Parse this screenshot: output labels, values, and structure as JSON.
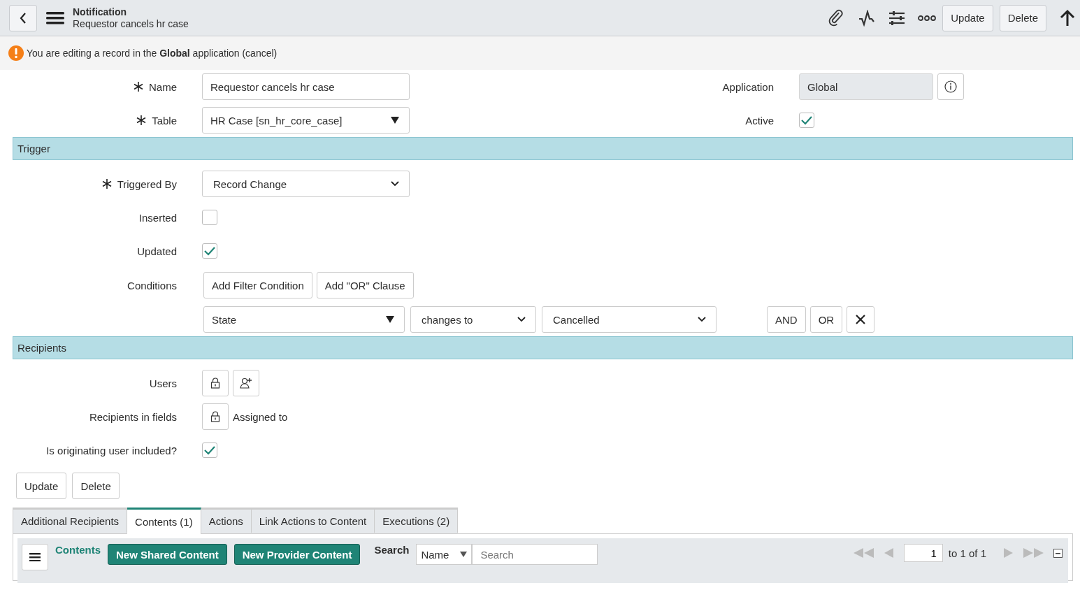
{
  "header": {
    "title": "Notification",
    "subtitle": "Requestor cancels hr case",
    "buttons": [
      "Update",
      "Delete"
    ]
  },
  "notice": {
    "text": "You are editing a record in the **Global** application",
    "link": "(cancel)"
  },
  "top_fields": {
    "name": {
      "label": "Name",
      "required": true,
      "value": "Requestor cancels hr case"
    },
    "table": {
      "label": "Table",
      "required": true,
      "value": "HR Case [sn_hr_core_case]"
    },
    "application": {
      "label": "Application",
      "value": "Global"
    },
    "active": {
      "label": "Active",
      "checked": true
    }
  },
  "trigger": {
    "title": "Trigger",
    "triggered_by": {
      "label": "Triggered By",
      "required": true,
      "value": "Record Change"
    },
    "inserted": {
      "label": "Inserted",
      "checked": false
    },
    "updated": {
      "label": "Updated",
      "checked": true
    },
    "conditions": {
      "label": "Conditions",
      "buttons": [
        "Add Filter Condition",
        "Add \"OR\" Clause"
      ],
      "row": {
        "field": "State",
        "operator": "changes to",
        "value": "Cancelled",
        "buttons": [
          "AND",
          "OR"
        ]
      }
    }
  },
  "recipients": {
    "title": "Recipients",
    "users": {
      "label": "Users"
    },
    "in_fields": {
      "label": "Recipients in fields",
      "value": "Assigned to"
    },
    "originating": {
      "label": "Is originating user included?",
      "checked": true
    }
  },
  "form_buttons": [
    "Update",
    "Delete"
  ],
  "tabs": [
    {
      "label": "Additional Recipients",
      "selected": false
    },
    {
      "label": "Contents (1)",
      "selected": true
    },
    {
      "label": "Actions",
      "selected": false
    },
    {
      "label": "Link Actions to Content",
      "selected": false
    },
    {
      "label": "Executions (2)",
      "selected": false
    }
  ],
  "related_list": {
    "title": "Contents",
    "buttons": [
      "New Shared Content",
      "New Provider Content"
    ],
    "search_label": "Search",
    "search_field": "Name",
    "search_placeholder": "Search",
    "page": "1",
    "page_of": "to 1 of 1"
  }
}
